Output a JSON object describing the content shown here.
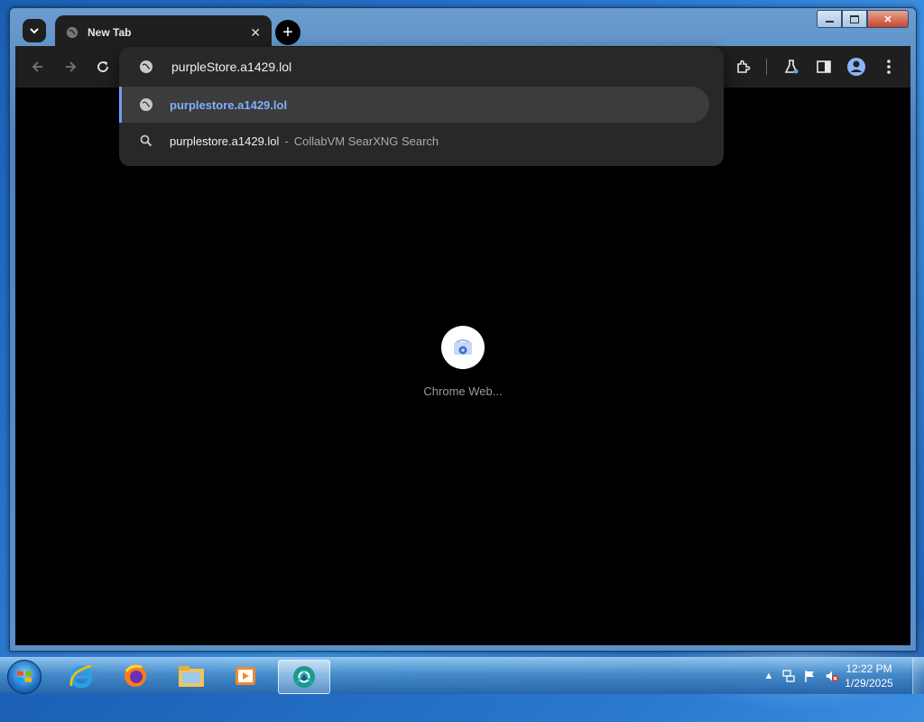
{
  "colors": {
    "accent_blue": "#6d9ef7",
    "chrome_dark": "#1f1f1f",
    "omnibox_bg": "#282828",
    "selected_row_bg": "#3c3c3c"
  },
  "window": {
    "caption": {
      "minimize_icon": "minimize-icon",
      "maximize_icon": "maximize-icon",
      "close_icon": "close-icon",
      "close_glyph": "✕"
    }
  },
  "tabs": [
    {
      "title": "New Tab",
      "icon": "globe-icon",
      "close_glyph": "✕"
    }
  ],
  "newtab_glyph": "+",
  "toolbar": {
    "back_icon": "back-arrow-icon",
    "forward_icon": "forward-arrow-icon",
    "reload_icon": "reload-icon",
    "extensions_icon": "puzzle-icon",
    "labs_icon": "flask-icon",
    "sidepanel_icon": "side-panel-icon",
    "profile_icon": "profile-icon",
    "menu_icon": "three-dot-menu-icon"
  },
  "omnibox": {
    "input_value": "purpleStore.a1429.lol",
    "suggestions": [
      {
        "text": "purplestore.a1429.lol",
        "icon": "globe-icon",
        "selected": true
      },
      {
        "text": "purplestore.a1429.lol",
        "separator": "-",
        "provider": "CollabVM SearXNG Search",
        "icon": "search-icon",
        "selected": false
      }
    ]
  },
  "ntp": {
    "shortcut_label": "Chrome Web...",
    "shortcut_icon": "chrome-web-store-icon"
  },
  "taskbar": {
    "apps": [
      {
        "name": "internet-explorer-icon"
      },
      {
        "name": "firefox-icon"
      },
      {
        "name": "file-explorer-icon"
      },
      {
        "name": "media-player-icon"
      },
      {
        "name": "chrome-icon",
        "active": true
      }
    ],
    "tray": {
      "show_hidden_glyph": "▲"
    },
    "clock": {
      "time": "12:22 PM",
      "date": "1/29/2025"
    }
  }
}
